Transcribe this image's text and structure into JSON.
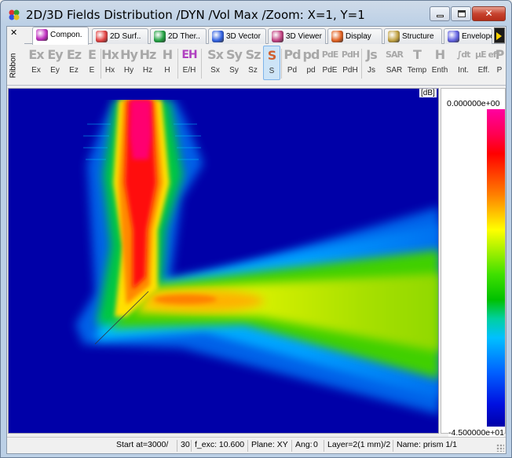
{
  "window": {
    "title": "2D/3D Fields Distribution /DYN /Vol Max /Zoom: X=1, Y=1",
    "minimize_glyph": "",
    "maximize_glyph": "",
    "close_glyph": "✕"
  },
  "ribbon": {
    "close_glyph": "✕",
    "side_label": "Ribbon",
    "tabs": [
      {
        "label": "Compon.",
        "icon": "component-e-icon",
        "active": true
      },
      {
        "label": "2D Surf..",
        "icon": "surface-icon"
      },
      {
        "label": "2D Ther..",
        "icon": "thermal-icon"
      },
      {
        "label": "3D Vector",
        "icon": "vector-icon"
      },
      {
        "label": "3D Viewer",
        "icon": "viewer-icon"
      },
      {
        "label": "Display",
        "icon": "display-icon"
      },
      {
        "label": "Structure",
        "icon": "structure-icon"
      },
      {
        "label": "Envelope",
        "icon": "envelope-icon"
      }
    ],
    "toolbar": [
      {
        "icon": "Ex",
        "label": "Ex"
      },
      {
        "icon": "Ey",
        "label": "Ey"
      },
      {
        "icon": "Ez",
        "label": "Ez"
      },
      {
        "icon": "E",
        "label": "E"
      },
      {
        "icon": "Hx",
        "label": "Hx"
      },
      {
        "icon": "Hy",
        "label": "Hy"
      },
      {
        "icon": "Hz",
        "label": "Hz"
      },
      {
        "icon": "H",
        "label": "H"
      },
      {
        "icon": "EH",
        "label": "E/H"
      },
      {
        "icon": "Sx",
        "label": "Sx"
      },
      {
        "icon": "Sy",
        "label": "Sy"
      },
      {
        "icon": "Sz",
        "label": "Sz"
      },
      {
        "icon": "S",
        "label": "S"
      },
      {
        "icon": "Pd",
        "label": "Pd"
      },
      {
        "icon": "pd",
        "label": "pd"
      },
      {
        "icon": "PdE",
        "label": "PdE"
      },
      {
        "icon": "PdH",
        "label": "PdH"
      },
      {
        "icon": "Js",
        "label": "Js"
      },
      {
        "icon": "SAR",
        "label": "SAR"
      },
      {
        "icon": "T",
        "label": "Temp"
      },
      {
        "icon": "H",
        "label": "Enth"
      },
      {
        "icon": "∫dt",
        "label": "Int."
      },
      {
        "icon": "μE eff",
        "label": "Eff."
      },
      {
        "icon": "P",
        "label": "P"
      }
    ],
    "selected": "S"
  },
  "plot": {
    "unit_tag": "[dB]",
    "colorbar_max": "0.000000e+00",
    "colorbar_min": "-4.500000e+01",
    "colors": {
      "background": "#0000a8",
      "max": "#ff0090",
      "high": "#ff0000",
      "mid_high": "#ffff00",
      "mid": "#00c000",
      "mid_low": "#00a0ff",
      "min": "#0000a8"
    }
  },
  "status": {
    "start": "Start at=3000/",
    "step": "30",
    "fexc": "f_exc: 10.600",
    "plane": "Plane: XY",
    "ang_label": "Ang:",
    "ang_value": "0",
    "layer": "Layer=2(1 mm)/2",
    "name": "Name: prism 1/1"
  }
}
